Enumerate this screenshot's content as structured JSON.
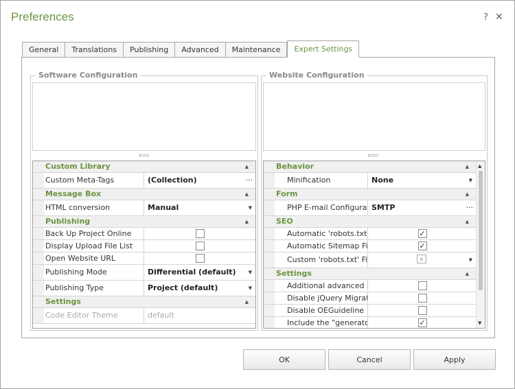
{
  "window": {
    "title": "Preferences",
    "help_glyph": "?",
    "close_glyph": "✕"
  },
  "tabs": [
    {
      "label": "General"
    },
    {
      "label": "Translations"
    },
    {
      "label": "Publishing"
    },
    {
      "label": "Advanced"
    },
    {
      "label": "Maintenance"
    },
    {
      "label": "Expert Settings",
      "active": true
    }
  ],
  "left_panel": {
    "title": "Software Configuration",
    "categories": {
      "custom_library": {
        "label": "Custom Library",
        "custom_meta_tags": {
          "name": "Custom Meta-Tags",
          "value": "(Collection)"
        }
      },
      "message_box": {
        "label": "Message Box",
        "html_conversion": {
          "name": "HTML conversion",
          "value": "Manual"
        }
      },
      "publishing": {
        "label": "Publishing",
        "back_up": {
          "name": "Back Up Project Online",
          "checked": false
        },
        "display_upload": {
          "name": "Display Upload File List",
          "checked": false
        },
        "open_url": {
          "name": "Open Website URL",
          "checked": false
        },
        "mode": {
          "name": "Publishing Mode",
          "value": "Differential (default)"
        },
        "type": {
          "name": "Publishing Type",
          "value": "Project (default)"
        }
      },
      "settings": {
        "label": "Settings",
        "code_editor_theme": {
          "name": "Code Editor Theme",
          "value": "default"
        }
      }
    }
  },
  "right_panel": {
    "title": "Website Configuration",
    "categories": {
      "behavior": {
        "label": "Behavior",
        "minification": {
          "name": "Minification",
          "value": "None"
        }
      },
      "form": {
        "label": "Form",
        "php_email": {
          "name": "PHP E-mail Configuration",
          "value": "SMTP"
        }
      },
      "seo": {
        "label": "SEO",
        "robots_auto": {
          "name": "Automatic 'robots.txt' File",
          "checked": true
        },
        "sitemap_auto": {
          "name": "Automatic Sitemap File",
          "checked": true
        },
        "robots_custom": {
          "name": "Custom 'robots.txt' File"
        }
      },
      "settings": {
        "label": "Settings",
        "additional_styles": {
          "name": "Additional advanced styles",
          "checked": false
        },
        "disable_jquery_migrate": {
          "name": "Disable jQuery Migrate",
          "checked": false
        },
        "disable_oeguideline": {
          "name": "Disable OEGuideline",
          "checked": false
        },
        "include_generator": {
          "name": "Include the \"generator\" meta-tag",
          "checked": true
        }
      }
    }
  },
  "buttons": {
    "ok": "OK",
    "cancel": "Cancel",
    "apply": "Apply"
  },
  "colors": {
    "accent": "#6a9441"
  },
  "icons": {
    "expand_collapse": "▲",
    "dropdown": "▼",
    "ellipsis": "···",
    "check": "✓",
    "file": "a"
  }
}
